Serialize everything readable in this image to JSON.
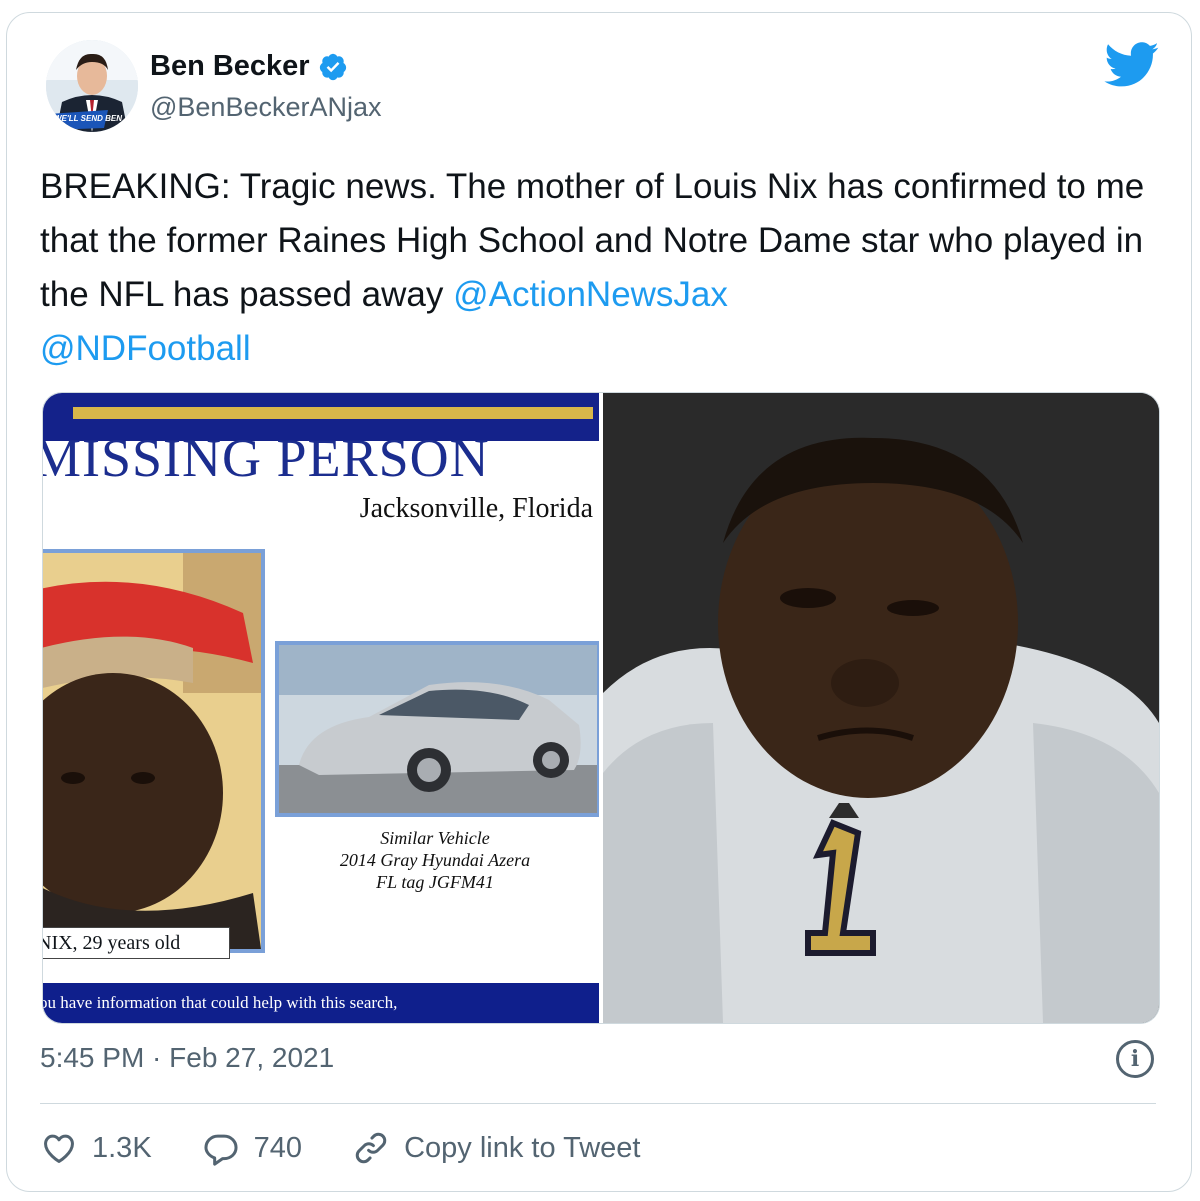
{
  "author": {
    "name": "Ben Becker",
    "handle": "@BenBeckerANjax",
    "avatar_badge": "WE'LL SEND BEN"
  },
  "tweet": {
    "text_before": "BREAKING: Tragic news. The mother of Louis Nix has confirmed to me that the former Raines High School and Notre Dame star who played in the NFL has passed away ",
    "mention_1": "@ActionNewsJax",
    "mention_2": "@NDFootball"
  },
  "media": {
    "poster": {
      "title": "MISSING PERSON",
      "city": "Jacksonville, Florida",
      "car_caption_1": "Similar Vehicle",
      "car_caption_2": "2014 Gray Hyundai Azera",
      "car_caption_3": "FL tag JGFM41",
      "name_tag": "NIX, 29 years old",
      "bottom_text": "ou have information that could help with this search,"
    },
    "photo_jersey_number": "1"
  },
  "timestamp": "5:45 PM · Feb 27, 2021",
  "actions": {
    "likes": "1.3K",
    "replies": "740",
    "copy_link": "Copy link to Tweet"
  },
  "colors": {
    "accent": "#1d9bf0",
    "secondary_text": "#536471",
    "border": "#cfd9de"
  }
}
